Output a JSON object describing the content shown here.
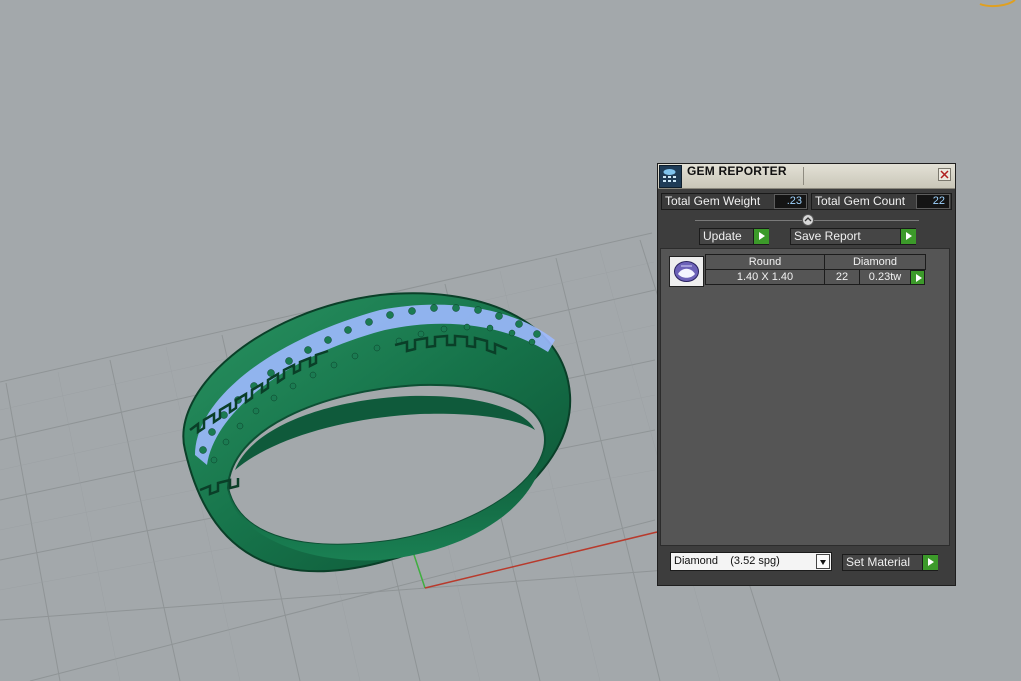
{
  "gem_reporter": {
    "title": "GEM REPORTER",
    "total_gem_weight_label": "Total Gem Weight",
    "total_gem_weight": ".23",
    "total_gem_count_label": "Total Gem Count",
    "total_gem_count": "22",
    "update_label": "Update",
    "save_report_label": "Save Report",
    "gems": [
      {
        "shape": "Round",
        "size": "1.40 X 1.40",
        "material": "Diamond",
        "count": "22",
        "weight": "0.23tw"
      }
    ],
    "material_select_value": "Diamond    (3.52 spg)",
    "set_material_label": "Set Material"
  },
  "colors": {
    "viewport_bg": "#a3a8ab",
    "ring_green": "#1f7a4f",
    "gem_blue": "#8fb4ff",
    "panel_bg": "#3d3d3d",
    "accent_green": "#3c9a2a"
  },
  "icons": [
    "app-logo-icon",
    "close-icon",
    "arrow-right-icon",
    "dropdown-chevron-icon",
    "round-gem-icon"
  ]
}
